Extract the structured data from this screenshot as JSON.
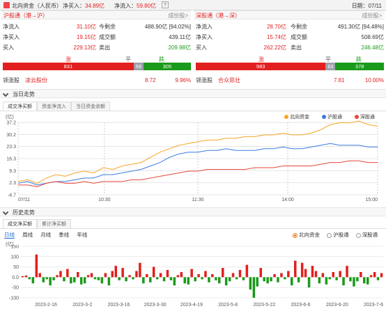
{
  "top": {
    "title": "北向资金（人民币）",
    "net_buy_label": "净买入：",
    "net_buy_value": "34.89亿",
    "net_inflow_label": "净流入：",
    "net_inflow_value": "59.80亿",
    "help": "?",
    "date": "日期：07/11"
  },
  "sh": {
    "title": "沪股通（港→沪）",
    "link": "成份股>",
    "rows": [
      {
        "l1": "净流入",
        "v1": "31.10亿",
        "l2": "今剩余",
        "v2": "488.90亿 [94.02%]"
      },
      {
        "l1": "净买入",
        "v1": "19.15亿",
        "l2": "成交额",
        "v2": "439.11亿"
      },
      {
        "l1": "买入",
        "v1": "229.13亿",
        "l2": "卖出",
        "v2": "209.98亿"
      }
    ],
    "up_label": "涨",
    "flat_label": "平",
    "down_label": "跌",
    "up": "831",
    "flat": "59",
    "down": "305",
    "leader_label": "领涨股",
    "leader_name": "凌云股份",
    "leader_price": "8.72",
    "leader_pct": "9.96%"
  },
  "sz": {
    "title": "深股通（港→深）",
    "link": "成份股>",
    "rows": [
      {
        "l1": "净流入",
        "v1": "28.70亿",
        "l2": "今剩余",
        "v2": "491.30亿 [94.48%]"
      },
      {
        "l1": "净买入",
        "v1": "15.74亿",
        "l2": "成交额",
        "v2": "508.69亿"
      },
      {
        "l1": "买入",
        "v1": "262.22亿",
        "l2": "卖出",
        "v2": "246.48亿"
      }
    ],
    "up_label": "涨",
    "flat_label": "平",
    "down_label": "跌",
    "up": "983",
    "flat": "63",
    "down": "378",
    "leader_label": "领涨股",
    "leader_name": "合众思壮",
    "leader_price": "7.81",
    "leader_pct": "10.00%"
  },
  "intraday": {
    "section_title": "当日走势",
    "tabs": [
      "成交净买额",
      "资金净流入",
      "当日资金余额"
    ],
    "unit": "(亿)",
    "legend": [
      "北向资金",
      "沪股通",
      "深股通"
    ]
  },
  "history": {
    "section_title": "历史走势",
    "tabs": [
      "成交净买额",
      "累计净买额"
    ],
    "periods": [
      "日线",
      "周线",
      "月线",
      "季线",
      "年线"
    ],
    "radios": [
      "北向资金",
      "沪股通",
      "深股通"
    ],
    "unit": "(亿)"
  },
  "colors": {
    "north": "#f5a623",
    "sh": "#3a7be0",
    "sz": "#e8463a",
    "up": "#e21f1f",
    "down": "#1a9a1a",
    "flat": "#9aa0a6"
  },
  "chart_data": [
    {
      "type": "line",
      "x_ticks": [
        "07/11",
        "10:30",
        "11:30",
        "14:00",
        "15:00"
      ],
      "y_ticks": [
        -4.7,
        2.3,
        9.3,
        16.3,
        23.3,
        30.2,
        37.2
      ],
      "ylim": [
        -4.7,
        37.2
      ],
      "series": [
        {
          "name": "北向资金",
          "values": [
            3,
            4,
            2,
            5,
            7,
            6,
            8,
            9,
            8,
            11,
            10,
            12,
            13,
            14,
            17,
            20,
            22,
            24,
            25,
            26,
            27,
            27,
            28,
            28,
            29,
            29,
            30,
            30,
            31,
            30,
            30,
            31,
            33,
            36,
            37,
            37,
            38,
            36,
            35
          ]
        },
        {
          "name": "沪股通",
          "values": [
            2,
            3,
            1,
            2,
            3,
            3,
            4,
            5,
            5,
            7,
            7,
            8,
            9,
            10,
            12,
            14,
            17,
            19,
            20,
            20,
            21,
            21,
            22,
            21,
            21,
            21,
            22,
            22,
            23,
            22,
            22,
            23,
            24,
            25,
            24,
            24,
            24,
            23,
            23
          ]
        },
        {
          "name": "深股通",
          "values": [
            1,
            1,
            0,
            2,
            3,
            2,
            2,
            3,
            2,
            3,
            3,
            3,
            4,
            4,
            5,
            6,
            7,
            8,
            9,
            9,
            10,
            10,
            10,
            10,
            10,
            11,
            11,
            11,
            12,
            12,
            12,
            12,
            13,
            14,
            14,
            15,
            15,
            14,
            14
          ]
        }
      ]
    },
    {
      "type": "bar",
      "x_ticks": [
        "2023-2-16",
        "2023-3-2",
        "2023-3-16",
        "2023-3-30",
        "2023-4-19",
        "2023-5-8",
        "2023-5-22",
        "2023-6-6",
        "2023-6-20",
        "2023-7-6"
      ],
      "y_ticks": [
        150,
        100,
        50,
        0.0,
        -50,
        -100
      ],
      "ylim": [
        -100,
        150
      ],
      "series": [
        {
          "name": "北向资金",
          "values": [
            5,
            8,
            -10,
            -30,
            110,
            20,
            -25,
            -10,
            -40,
            -15,
            10,
            30,
            -20,
            40,
            -30,
            -25,
            25,
            -35,
            -30,
            10,
            20,
            -10,
            -15,
            -30,
            20,
            -40,
            30,
            55,
            -15,
            45,
            -20,
            10,
            -10,
            30,
            70,
            -30,
            15,
            -25,
            50,
            -10,
            20,
            -20,
            35,
            -15,
            -40,
            10,
            25,
            -30,
            -35,
            40,
            -20,
            15,
            -10,
            30,
            -25,
            15,
            -15,
            -30,
            45,
            -40,
            -20,
            20,
            -10,
            35,
            -15,
            60,
            -60,
            -100,
            -45,
            45,
            -20,
            -30,
            -20,
            15,
            -25,
            20,
            -10,
            30,
            -40,
            80,
            -25,
            70,
            40,
            -50,
            55,
            30,
            -30,
            20,
            -35,
            -10,
            25,
            -15,
            30,
            -40,
            55,
            -20,
            -45,
            -20,
            25,
            -30,
            -35,
            10,
            25,
            -15,
            20
          ]
        }
      ]
    }
  ]
}
